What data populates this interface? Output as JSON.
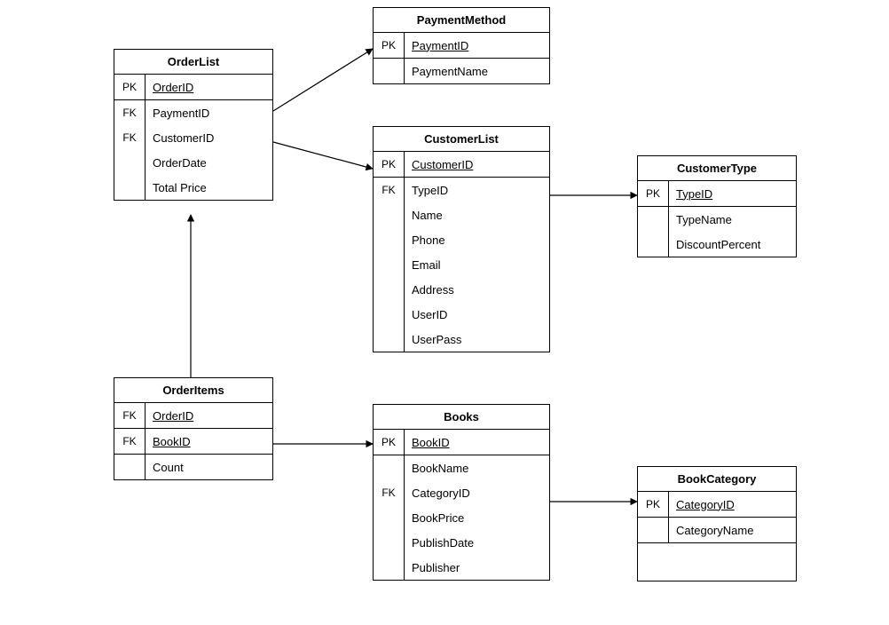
{
  "entities": {
    "orderList": {
      "title": "OrderList",
      "rows": [
        {
          "key": "PK",
          "field": "OrderID",
          "pk": true,
          "bordered": true
        },
        {
          "key": "FK",
          "field": "PaymentID"
        },
        {
          "key": "FK",
          "field": "CustomerID"
        },
        {
          "key": "",
          "field": "OrderDate"
        },
        {
          "key": "",
          "field": "Total Price"
        }
      ]
    },
    "paymentMethod": {
      "title": "PaymentMethod",
      "rows": [
        {
          "key": "PK",
          "field": "PaymentID",
          "pk": true,
          "bordered": true
        },
        {
          "key": "",
          "field": "PaymentName"
        }
      ]
    },
    "customerList": {
      "title": "CustomerList",
      "rows": [
        {
          "key": "PK",
          "field": "CustomerID",
          "pk": true,
          "bordered": true
        },
        {
          "key": "FK",
          "field": "TypeID"
        },
        {
          "key": "",
          "field": "Name"
        },
        {
          "key": "",
          "field": "Phone"
        },
        {
          "key": "",
          "field": "Email"
        },
        {
          "key": "",
          "field": "Address"
        },
        {
          "key": "",
          "field": "UserID"
        },
        {
          "key": "",
          "field": "UserPass"
        }
      ]
    },
    "customerType": {
      "title": "CustomerType",
      "rows": [
        {
          "key": "PK",
          "field": "TypeID",
          "pk": true,
          "bordered": true
        },
        {
          "key": "",
          "field": "TypeName"
        },
        {
          "key": "",
          "field": "DiscountPercent"
        }
      ]
    },
    "orderItems": {
      "title": "OrderItems",
      "rows": [
        {
          "key": "FK",
          "field": "OrderID",
          "pk": true,
          "bordered": true
        },
        {
          "key": "FK",
          "field": "BookID",
          "pk": true,
          "bordered": true
        },
        {
          "key": "",
          "field": "Count"
        }
      ]
    },
    "books": {
      "title": "Books",
      "rows": [
        {
          "key": "PK",
          "field": "BookID",
          "pk": true,
          "bordered": true
        },
        {
          "key": "",
          "field": "BookName"
        },
        {
          "key": "FK",
          "field": "CategoryID"
        },
        {
          "key": "",
          "field": "BookPrice"
        },
        {
          "key": "",
          "field": "PublishDate"
        },
        {
          "key": "",
          "field": "Publisher"
        }
      ]
    },
    "bookCategory": {
      "title": "BookCategory",
      "rows": [
        {
          "key": "PK",
          "field": "CategoryID",
          "pk": true,
          "bordered": true
        },
        {
          "key": "",
          "field": "CategoryName"
        }
      ]
    }
  },
  "relationships": [
    {
      "from": "OrderList.PaymentID",
      "to": "PaymentMethod.PaymentID"
    },
    {
      "from": "OrderList.CustomerID",
      "to": "CustomerList.CustomerID"
    },
    {
      "from": "CustomerList.TypeID",
      "to": "CustomerType.TypeID"
    },
    {
      "from": "OrderItems.OrderID",
      "to": "OrderList.OrderID"
    },
    {
      "from": "OrderItems.BookID",
      "to": "Books.BookID"
    },
    {
      "from": "Books.CategoryID",
      "to": "BookCategory.CategoryID"
    }
  ]
}
